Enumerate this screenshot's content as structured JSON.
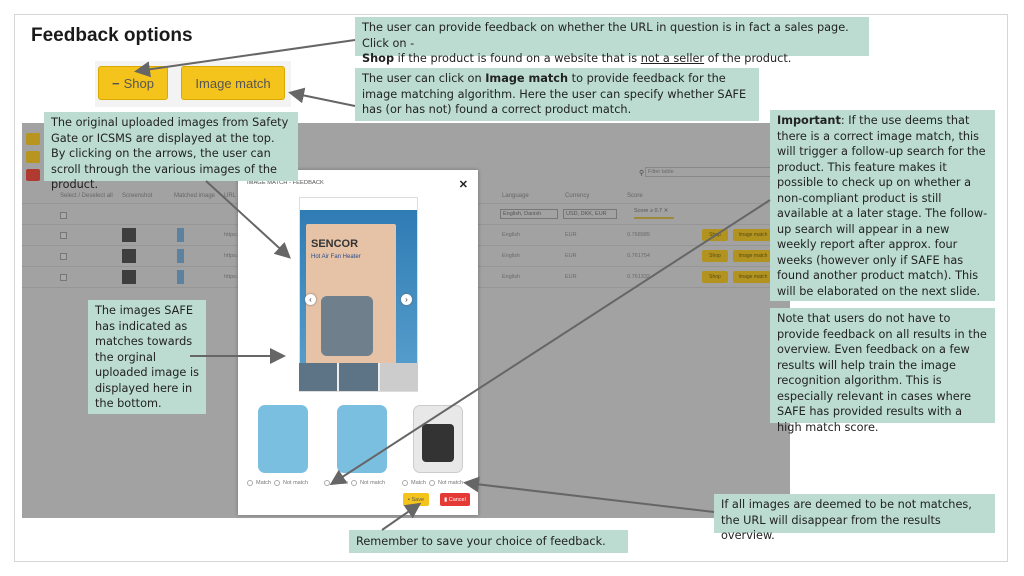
{
  "slide": {
    "title": "Feedback options"
  },
  "buttons": {
    "shop": "Shop",
    "shop_icon": "minus-icon",
    "image_match": "Image match"
  },
  "callouts": {
    "shop_pre": "The user can provide feedback on whether the URL in question is in fact a sales page. Click on -",
    "shop_bold": "Shop",
    "shop_mid": " if the product is found on a website that is ",
    "shop_underline": "not a seller",
    "shop_post": " of the product.",
    "match_pre": "The user can click on ",
    "match_bold": "Image match",
    "match_post": " to provide feedback for the image matching algorithm. Here the user can specify whether SAFE has (or has not) found a correct product match.",
    "original": "The original uploaded images from Safety Gate or ICSMS are displayed at the top. By clicking on the arrows, the user can scroll through the various images of the product.",
    "important_bold": "Important",
    "important_text": ": If the use deems that there is a correct image match, this will trigger a follow-up search for the product. This feature makes it possible to check up on whether a non-compliant product is still available at a later stage. The follow-up search will appear in a new weekly report after approx. four weeks (however only if SAFE has found another product match). This will be elaborated on the next slide.",
    "note_text": "Note that users do not have to provide feedback on all results in the overview. Even feedback on a few results will help train the image recognition algorithm. This ",
    "note_emph": "is especially relevant in cases where SAFE has provided results with a high match score.",
    "matches": "The images SAFE has indicated as matches towards the orginal uploaded image is displayed here in the bottom.",
    "not_matches": "If all images are deemed to be not matches, the URL will disappear from the results overview.",
    "save": "Remember to save your choice of feedback."
  },
  "table": {
    "filter_placeholder": "Filter table",
    "headers": [
      "Select / Deselect all",
      "Screenshot",
      "Matched image",
      "URL",
      "Language",
      "Currency",
      "Score"
    ],
    "filters": {
      "language": "English, Danish",
      "currency": "USD, DKK, EUR",
      "score": "Score ≥ 0.7"
    },
    "rows": [
      {
        "url": "https://...",
        "language": "English",
        "currency": "EUR",
        "score": "0.768985"
      },
      {
        "url": "https://...",
        "language": "English",
        "currency": "EUR",
        "score": "0.761754"
      },
      {
        "url": "https://...",
        "language": "English",
        "currency": "EUR",
        "score": "0.761332"
      }
    ],
    "row_shop": "Shop",
    "row_image_match": "Image match"
  },
  "modal": {
    "title": "IMAGE MATCH - FEEDBACK",
    "close": "✕",
    "product_brand": "SENCOR",
    "product_name": "Hot Air Fan Heater",
    "match_label": "Match",
    "not_match_label": "Not match",
    "save": "Save",
    "cancel": "Cancel"
  },
  "colors": {
    "callout": "#bcdcd2",
    "button": "#f4c41c",
    "cancel": "#e53935"
  }
}
